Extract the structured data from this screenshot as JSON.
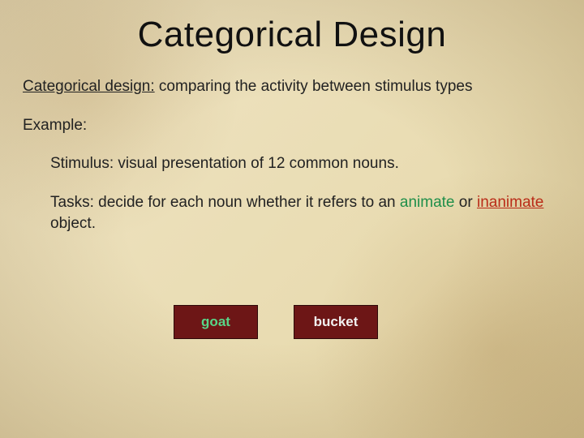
{
  "title": "Categorical Design",
  "definition": {
    "term": "Categorical design:",
    "text": " comparing the activity between stimulus types"
  },
  "example_label": "Example:",
  "stimulus": {
    "label": "Stimulus:  ",
    "text": "visual presentation of 12 common nouns."
  },
  "tasks": {
    "label": "Tasks: ",
    "pre": "decide for each noun whether it refers to an ",
    "animate": "animate",
    "mid": " or ",
    "inanimate": "inanimate",
    "post": " object."
  },
  "chips": {
    "animate_example": "goat",
    "inanimate_example": "bucket"
  },
  "colors": {
    "animate": "#1f8f4a",
    "inanimate": "#ba2c18",
    "chip_bg": "#6d1616"
  }
}
